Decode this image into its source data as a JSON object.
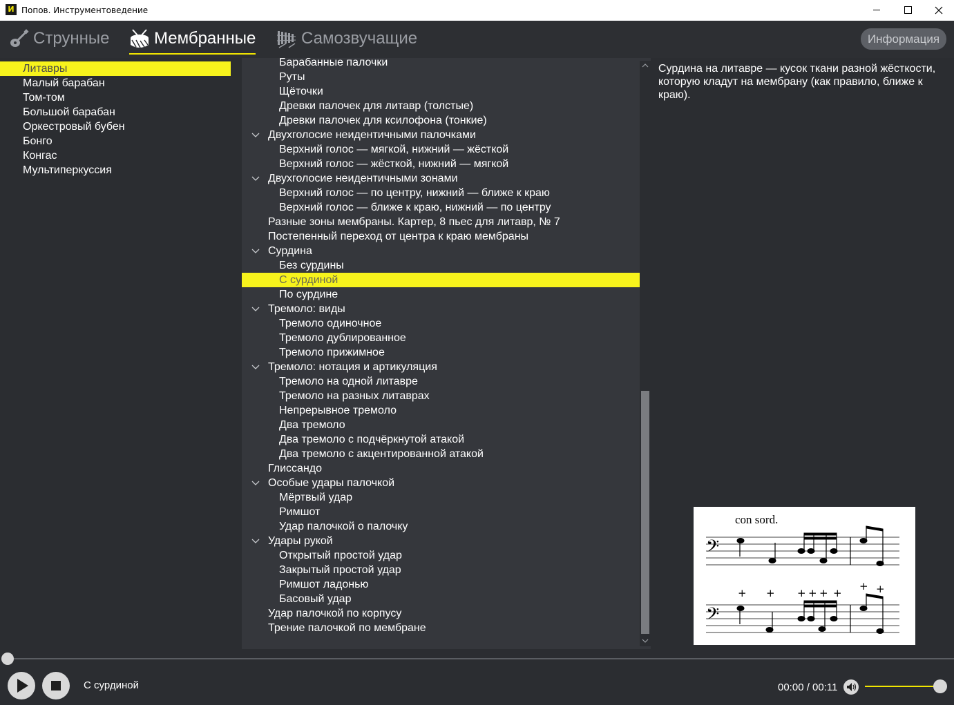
{
  "window": {
    "app_icon": "И",
    "title": "Попов. Инструментоведение"
  },
  "tabs": [
    {
      "label": "Струнные",
      "icon": "guitar-icon"
    },
    {
      "label": "Мембранные",
      "icon": "drum-icon",
      "active": true
    },
    {
      "label": "Самозвучащие",
      "icon": "xylophone-icon"
    }
  ],
  "info_button": "Информация",
  "instruments": [
    {
      "label": "Литавры",
      "selected": true
    },
    {
      "label": "Малый барабан"
    },
    {
      "label": "Том-том"
    },
    {
      "label": "Большой барабан"
    },
    {
      "label": "Оркестровый бубен"
    },
    {
      "label": "Бонго"
    },
    {
      "label": "Конгас"
    },
    {
      "label": "Мультиперкуссия"
    }
  ],
  "tree": [
    {
      "label": "Барабанные палочки",
      "level": 2
    },
    {
      "label": "Руты",
      "level": 2
    },
    {
      "label": "Щёточки",
      "level": 2
    },
    {
      "label": "Древки палочек для литавр (толстые)",
      "level": 2
    },
    {
      "label": "Древки палочек для ксилофона (тонкие)",
      "level": 2
    },
    {
      "label": "Двухголосие неидентичными палочками",
      "level": 1,
      "expanded": true
    },
    {
      "label": "Верхний голос — мягкой, нижний — жёсткой",
      "level": 2
    },
    {
      "label": "Верхний голос — жёсткой, нижний — мягкой",
      "level": 2
    },
    {
      "label": "Двухголосие неидентичными зонами",
      "level": 1,
      "expanded": true
    },
    {
      "label": "Верхний голос — по центру, нижний — ближе к краю",
      "level": 2
    },
    {
      "label": "Верхний голос — ближе к краю, нижний — по центру",
      "level": 2
    },
    {
      "label": "Разные зоны мембраны. Картер, 8 пьес для литавр, № 7",
      "level": 1
    },
    {
      "label": "Постепенный переход от центра к краю мембраны",
      "level": 1
    },
    {
      "label": "Сурдина",
      "level": 1,
      "expanded": true
    },
    {
      "label": "Без сурдины",
      "level": 2
    },
    {
      "label": "С сурдиной",
      "level": 2,
      "selected": true
    },
    {
      "label": "По сурдине",
      "level": 2
    },
    {
      "label": "Тремоло: виды",
      "level": 1,
      "expanded": true
    },
    {
      "label": "Тремоло одиночное",
      "level": 2
    },
    {
      "label": "Тремоло дублированное",
      "level": 2
    },
    {
      "label": "Тремоло прижимное",
      "level": 2
    },
    {
      "label": "Тремоло: нотация и артикуляция",
      "level": 1,
      "expanded": true
    },
    {
      "label": "Тремоло на одной литавре",
      "level": 2
    },
    {
      "label": "Тремоло на разных литаврах",
      "level": 2
    },
    {
      "label": "Непрерывное тремоло",
      "level": 2
    },
    {
      "label": "Два тремоло",
      "level": 2
    },
    {
      "label": "Два тремоло с подчёркнутой атакой",
      "level": 2
    },
    {
      "label": "Два тремоло с акцентированной атакой",
      "level": 2
    },
    {
      "label": "Глиссандо",
      "level": 1
    },
    {
      "label": "Особые удары палочкой",
      "level": 1,
      "expanded": true
    },
    {
      "label": "Мёртвый удар",
      "level": 2
    },
    {
      "label": "Римшот",
      "level": 2
    },
    {
      "label": "Удар палочкой о палочку",
      "level": 2
    },
    {
      "label": "Удары рукой",
      "level": 1,
      "expanded": true
    },
    {
      "label": "Открытый простой удар",
      "level": 2
    },
    {
      "label": "Закрытый простой удар",
      "level": 2
    },
    {
      "label": "Римшот ладонью",
      "level": 2
    },
    {
      "label": "Басовый удар",
      "level": 2
    },
    {
      "label": "Удар палочкой по корпусу",
      "level": 1
    },
    {
      "label": "Трение палочкой по мембране",
      "level": 1
    }
  ],
  "tree_scroll": {
    "position_fraction": 0.56
  },
  "description": "Сурдина на литавре — кусок ткани разной жёсткости, которую кладут на мембрану (как правило, ближе к краю).",
  "notation": {
    "direction": "con sord.",
    "marks": "+"
  },
  "player": {
    "now_playing": "С сурдиной",
    "time": "00:00 / 00:11",
    "progress": 0,
    "volume": 1.0
  },
  "colors": {
    "accent": "#f7f31c",
    "background": "#2b2d31",
    "tree_background": "#35373c"
  }
}
